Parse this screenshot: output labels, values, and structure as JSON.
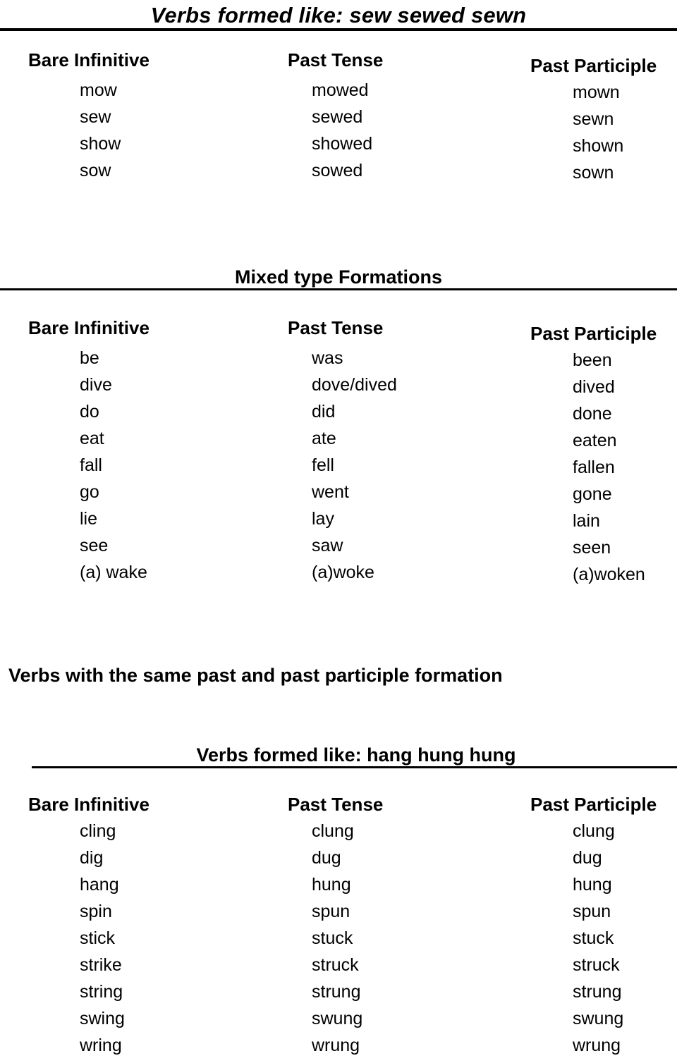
{
  "document": {
    "sections": [
      {
        "id": "sew-group",
        "title": "Verbs formed like: sew sewed sewn",
        "title_style": "bold-italic-underlined",
        "columns": [
          {
            "header": "Bare Infinitive",
            "items": [
              "mow",
              "sew",
              "show",
              "sow"
            ]
          },
          {
            "header": "Past Tense",
            "items": [
              "mowed",
              "sewed",
              "showed",
              "sowed"
            ]
          },
          {
            "header": "Past Participle",
            "items": [
              "mown",
              "sewn",
              "shown",
              "sown"
            ]
          }
        ]
      },
      {
        "id": "mixed-group",
        "title": "Mixed type Formations",
        "title_style": "bold-underlined",
        "columns": [
          {
            "header": "Bare Infinitive",
            "items": [
              "be",
              "dive",
              "do",
              "eat",
              "fall",
              "go",
              "lie",
              "see",
              "(a) wake"
            ]
          },
          {
            "header": "Past Tense",
            "items": [
              "was",
              "dove/dived",
              "did",
              "ate",
              "fell",
              "went",
              "lay",
              "saw",
              "(a)woke"
            ]
          },
          {
            "header": "Past Participle",
            "items": [
              "been",
              "dived",
              "done",
              "eaten",
              "fallen",
              "gone",
              "lain",
              "seen",
              "(a)woken"
            ]
          }
        ]
      },
      {
        "id": "same-past-heading",
        "title": "Verbs with the same past and past participle formation",
        "title_style": "bold"
      },
      {
        "id": "hang-group",
        "title": "Verbs formed like: hang hung hung",
        "title_style": "bold-underlined",
        "columns": [
          {
            "header": "Bare Infinitive",
            "items": [
              "cling",
              "dig",
              "hang",
              "spin",
              "stick",
              "strike",
              "string",
              "swing",
              "wring"
            ]
          },
          {
            "header": "Past Tense",
            "items": [
              "clung",
              "dug",
              "hung",
              "spun",
              "stuck",
              "struck",
              "strung",
              "swung",
              "wrung"
            ]
          },
          {
            "header": "Past Participle",
            "items": [
              "clung",
              "dug",
              "hung",
              "spun",
              "stuck",
              "struck",
              "strung",
              "swung",
              "wrung"
            ]
          }
        ]
      }
    ]
  }
}
